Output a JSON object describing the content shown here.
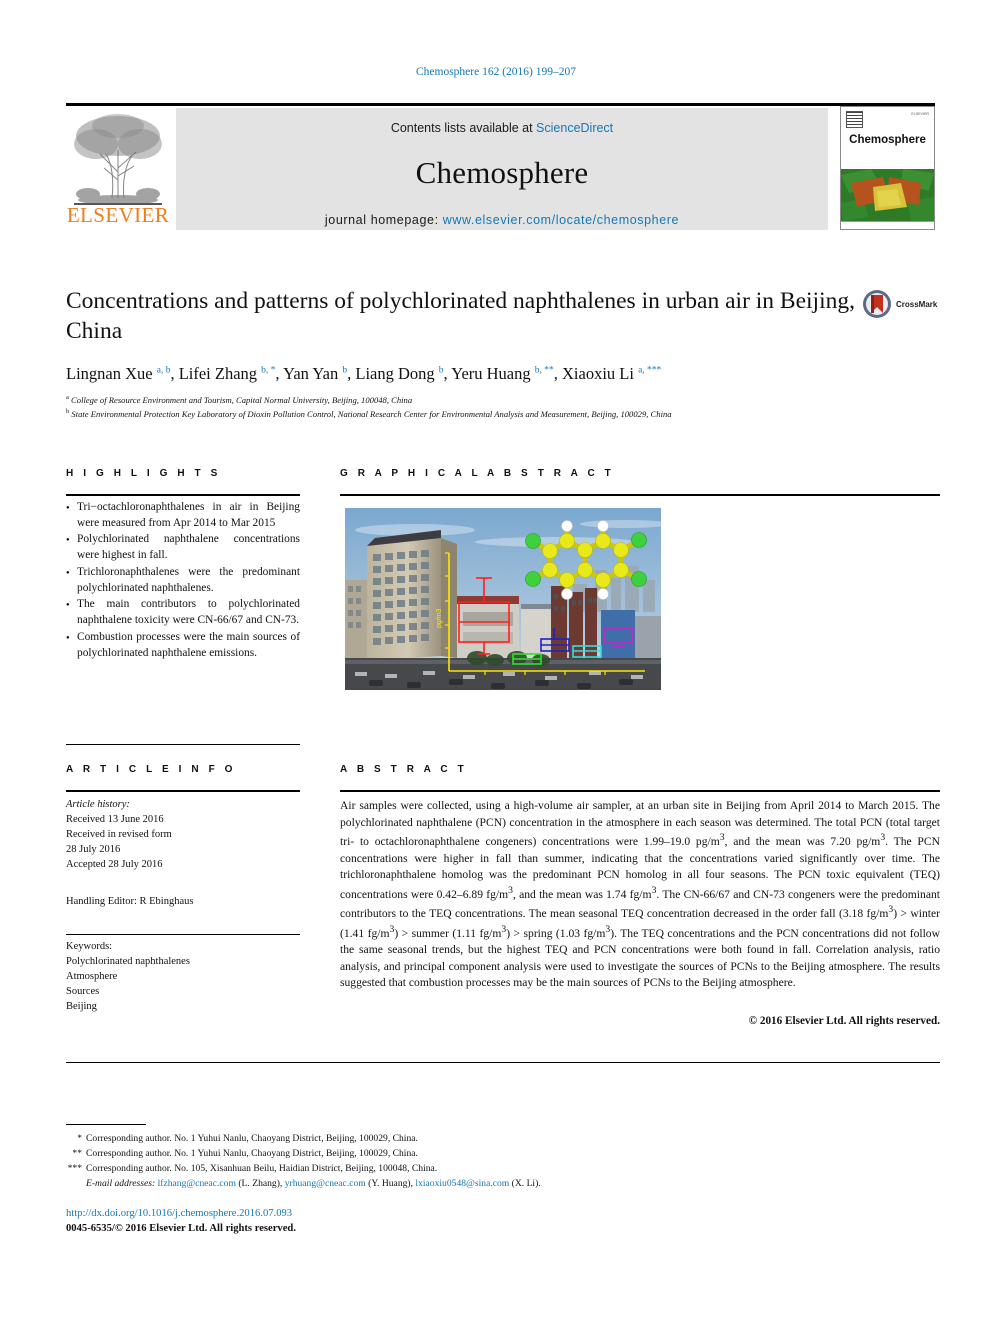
{
  "running_head": "Chemosphere 162 (2016) 199–207",
  "masthead": {
    "contents_prefix": "Contents lists available at ",
    "sciencedirect": "ScienceDirect",
    "journal_title": "Chemosphere",
    "homepage_prefix": "journal homepage: ",
    "homepage_url": "www.elsevier.com/locate/chemosphere",
    "publisher": "ELSEVIER",
    "cover_journal_name": "Chemosphere",
    "cover_top_right": "ELSEVIER"
  },
  "article": {
    "title": "Concentrations and patterns of polychlorinated naphthalenes in urban air in Beijing, China",
    "authors": [
      {
        "name": "Lingnan Xue",
        "marks": "a, b"
      },
      {
        "name": "Lifei Zhang",
        "marks": "b, *"
      },
      {
        "name": "Yan Yan",
        "marks": "b"
      },
      {
        "name": "Liang Dong",
        "marks": "b"
      },
      {
        "name": "Yeru Huang",
        "marks": "b, **"
      },
      {
        "name": "Xiaoxiu Li",
        "marks": "a, ***"
      }
    ],
    "affiliations": [
      {
        "mark": "a",
        "text": "College of Resource Environment and Tourism, Capital Normal University, Beijing, 100048, China"
      },
      {
        "mark": "b",
        "text": "State Environmental Protection Key Laboratory of Dioxin Pollution Control, National Research Center for Environmental Analysis and Measurement, Beijing, 100029, China"
      }
    ],
    "crossmark_label": "CrossMark"
  },
  "sections": {
    "highlights_heading": "H I G H L I G H T S",
    "graphical_abstract_heading": "G R A P H I C A L   A B S T R A C T",
    "article_info_heading": "A R T I C L E   I N F O",
    "abstract_heading": "A B S T R A C T"
  },
  "highlights": [
    "Tri−octachloronaphthalenes in air in Beijing were measured from Apr 2014 to Mar 2015",
    "Polychlorinated naphthalene concentrations were highest in fall.",
    "Trichloronaphthalenes were the predominant polychlorinated naphthalenes.",
    "The main contributors to polychlorinated naphthalene toxicity were CN-66/67 and CN-73.",
    "Combustion processes were the main sources of polychlorinated naphthalene emissions."
  ],
  "article_info": {
    "history_label": "Article history:",
    "received": "Received 13 June 2016",
    "revised_label": "Received in revised form",
    "revised_date": "28 July 2016",
    "accepted": "Accepted 28 July 2016",
    "handling_editor": "Handling Editor: R Ebinghaus",
    "keywords_label": "Keywords:",
    "keywords": [
      "Polychlorinated naphthalenes",
      "Atmosphere",
      "Sources",
      "Beijing"
    ]
  },
  "abstract": {
    "text": "Air samples were collected, using a high-volume air sampler, at an urban site in Beijing from April 2014 to March 2015. The polychlorinated naphthalene (PCN) concentration in the atmosphere in each season was determined. The total PCN (total target tri- to octachloronaphthalene congeners) concentrations were 1.99–19.0 pg/m3, and the mean was 7.20 pg/m3. The PCN concentrations were higher in fall than summer, indicating that the concentrations varied significantly over time. The trichloronaphthalene homolog was the predominant PCN homolog in all four seasons. The PCN toxic equivalent (TEQ) concentrations were 0.42–6.89 fg/m3, and the mean was 1.74 fg/m3. The CN-66/67 and CN-73 congeners were the predominant contributors to the TEQ concentrations. The mean seasonal TEQ concentration decreased in the order fall (3.18 fg/m3) > winter (1.41 fg/m3) > summer (1.11 fg/m3) > spring (1.03 fg/m3). The TEQ concentrations and the PCN concentrations did not follow the same seasonal trends, but the highest TEQ and PCN concentrations were both found in fall. Correlation analysis, ratio analysis, and principal component analysis were used to investigate the sources of PCNs to the Beijing atmosphere. The results suggested that combustion processes may be the main sources of PCNs to the Beijing atmosphere.",
    "copyright": "© 2016 Elsevier Ltd. All rights reserved."
  },
  "footnotes": [
    {
      "mark": "*",
      "text": "Corresponding author. No. 1 Yuhui Nanlu, Chaoyang District, Beijing, 100029, China."
    },
    {
      "mark": "**",
      "text": "Corresponding author. No. 1 Yuhui Nanlu, Chaoyang District, Beijing, 100029, China."
    },
    {
      "mark": "***",
      "text": "Corresponding author. No. 105, Xisanhuan Beilu, Haidian District, Beijing, 100048, China."
    }
  ],
  "emails": {
    "label": "E-mail addresses:",
    "entries": [
      {
        "address": "lfzhang@cneac.com",
        "person": "(L. Zhang)"
      },
      {
        "address": "yrhuang@cneac.com",
        "person": "(Y. Huang)"
      },
      {
        "address": "lxiaoxiu0548@sina.com",
        "person": "(X. Li)"
      }
    ]
  },
  "doi_url": "http://dx.doi.org/10.1016/j.chemosphere.2016.07.093",
  "issn_line": "0045-6535/© 2016 Elsevier Ltd. All rights reserved.",
  "graphical_abstract": {
    "description": "Beijing urban skyline photograph with an overlaid polychlorinated naphthalene molecular model and colored box-and-whisker plots of seasonal concentrations",
    "axis_label": "pg/m3",
    "molecule_colors": {
      "carbon": "#e8e81a",
      "chlorine": "#3fd03f",
      "hydrogen": "#ffffff"
    },
    "box_colors": [
      "#ff1f1f",
      "#1f22c8",
      "#2fe02f",
      "#2fe0e0",
      "#cc22cc"
    ]
  }
}
